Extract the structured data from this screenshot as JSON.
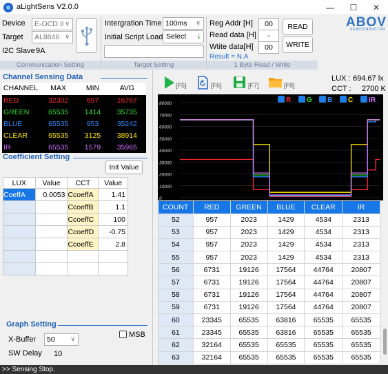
{
  "window": {
    "title": "aLightSens V2.0.0"
  },
  "comm": {
    "device_label": "Device",
    "device_value": "E-OCD II",
    "target_label": "Target",
    "target_value": "AL8846",
    "i2c_label": "I2C Slave",
    "i2c_value": "9A",
    "group_title": "Communication Setting"
  },
  "target": {
    "integration_label": "Intergration Time",
    "integration_value": "100ms",
    "script_label": "Initial Script Load",
    "select_label": "Select",
    "script_path": "",
    "group_title": "Target Setting"
  },
  "rw": {
    "reg_addr_label": "Reg Addr  [H]",
    "reg_addr_value": "00",
    "read_data_label": "Read data [H]",
    "read_data_value": "-",
    "write_data_label": "Wtite data[H]",
    "write_data_value": "00",
    "read_button": "READ",
    "write_button": "WRITE",
    "result": "Result = N.A",
    "group_title": "1 Byte Read / Write"
  },
  "logo": {
    "text": "ABOV",
    "sub": "SEMICONDUCTOR"
  },
  "toolbar": {
    "f5": "[F5]",
    "f6": "[F6]",
    "f7": "[F7]",
    "f8": "[F8]"
  },
  "readout": {
    "lux_label": "LUX :",
    "lux_value": "694.67 lx",
    "cct_label": "CCT :",
    "cct_value": "2700 K"
  },
  "channel": {
    "title": "Channel Sensing Data",
    "headers": [
      "CHANNEL",
      "MAX",
      "MIN",
      "AVG"
    ],
    "rows": [
      {
        "name": "RED",
        "max": "32302",
        "min": "697",
        "avg": "16767"
      },
      {
        "name": "GREEN",
        "max": "65535",
        "min": "1414",
        "avg": "35735"
      },
      {
        "name": "BLUE",
        "max": "65535",
        "min": "953",
        "avg": "35242"
      },
      {
        "name": "CLEAR",
        "max": "65535",
        "min": "3125",
        "avg": "38914"
      },
      {
        "name": "IR",
        "max": "65535",
        "min": "1579",
        "avg": "35965"
      }
    ],
    "colors": {
      "RED": "#ff2a2a",
      "GREEN": "#2fe02f",
      "BLUE": "#2f8bff",
      "CLEAR": "#ffe600",
      "IR": "#d070ff"
    }
  },
  "coef": {
    "title": "Coefficient Setting",
    "init_button": "Init Value",
    "headers": [
      "LUX",
      "Value",
      "CCT",
      "Value"
    ],
    "rows": [
      {
        "lux": "CoeffA",
        "lux_value": "0.0053",
        "cct": "CcoeffA",
        "cct_value": "1.41"
      },
      {
        "lux": "",
        "lux_value": "",
        "cct": "CcoeffB",
        "cct_value": "1.1"
      },
      {
        "lux": "",
        "lux_value": "",
        "cct": "CcoeffC",
        "cct_value": "100"
      },
      {
        "lux": "",
        "lux_value": "",
        "cct": "CcoeffD",
        "cct_value": "-0.75"
      },
      {
        "lux": "",
        "lux_value": "",
        "cct": "CcoeffE",
        "cct_value": "2.8"
      }
    ]
  },
  "graph_setting": {
    "title": "Graph Setting",
    "xbuffer_label": "X-Buffer",
    "xbuffer_value": "50",
    "msb_label": "MSB",
    "msb_checked": false,
    "swdelay_label": "SW Delay",
    "swdelay_value": "10"
  },
  "legend": [
    "R",
    "G",
    "B",
    "C",
    "IR"
  ],
  "chart_data": {
    "type": "line",
    "ylim": [
      0,
      80000
    ],
    "yticks": [
      "80000",
      "70000",
      "60000",
      "50000",
      "40000",
      "30000",
      "20000",
      "10000",
      "0"
    ],
    "x": [
      0,
      1,
      2,
      3,
      4,
      5,
      6,
      7,
      8,
      9,
      10,
      11,
      12,
      13,
      14,
      15,
      16,
      17,
      18,
      19,
      20,
      21,
      22,
      23,
      24,
      25,
      26,
      27,
      28,
      29,
      30,
      31,
      32,
      33,
      34,
      35,
      36,
      37,
      38,
      39,
      40,
      41,
      42,
      43,
      44,
      45,
      46,
      47,
      48,
      49
    ],
    "series": [
      {
        "name": "R",
        "color": "#ff2a2a",
        "values": [
          32164,
          32164,
          32164,
          32164,
          32164,
          32164,
          32164,
          32164,
          32164,
          32164,
          32164,
          32164,
          32164,
          32164,
          32164,
          32164,
          32164,
          32164,
          6731,
          6731,
          6731,
          6731,
          957,
          957,
          957,
          957,
          957,
          957,
          957,
          957,
          957,
          957,
          957,
          957,
          957,
          957,
          957,
          957,
          957,
          957,
          957,
          957,
          6731,
          6731,
          6731,
          6731,
          23345,
          23345,
          32164,
          32164
        ]
      },
      {
        "name": "G",
        "color": "#2fe02f",
        "values": [
          65535,
          65535,
          65535,
          65535,
          65535,
          65535,
          65535,
          65535,
          65535,
          65535,
          65535,
          65535,
          65535,
          65535,
          65535,
          65535,
          65535,
          65535,
          19126,
          19126,
          19126,
          19126,
          2023,
          2023,
          2023,
          2023,
          2023,
          2023,
          2023,
          2023,
          2023,
          2023,
          2023,
          2023,
          2023,
          2023,
          2023,
          2023,
          2023,
          2023,
          2023,
          2023,
          19126,
          19126,
          19126,
          19126,
          65535,
          65535,
          65535,
          65535
        ]
      },
      {
        "name": "B",
        "color": "#2f8bff",
        "values": [
          65535,
          65535,
          65535,
          65535,
          65535,
          65535,
          65535,
          65535,
          65535,
          65535,
          65535,
          65535,
          65535,
          65535,
          65535,
          65535,
          65535,
          65535,
          17564,
          17564,
          17564,
          17564,
          1429,
          1429,
          1429,
          1429,
          1429,
          1429,
          1429,
          1429,
          1429,
          1429,
          1429,
          1429,
          1429,
          1429,
          1429,
          1429,
          1429,
          1429,
          1429,
          1429,
          17564,
          17564,
          17564,
          17564,
          63816,
          63816,
          65535,
          65535
        ]
      },
      {
        "name": "C",
        "color": "#ffe600",
        "values": [
          65535,
          65535,
          65535,
          65535,
          65535,
          65535,
          65535,
          65535,
          65535,
          65535,
          65535,
          65535,
          65535,
          65535,
          65535,
          65535,
          65535,
          65535,
          44764,
          44764,
          44764,
          44764,
          4534,
          4534,
          4534,
          4534,
          4534,
          4534,
          4534,
          4534,
          4534,
          4534,
          4534,
          4534,
          4534,
          4534,
          4534,
          4534,
          4534,
          4534,
          4534,
          4534,
          44764,
          44764,
          44764,
          44764,
          65535,
          65535,
          65535,
          65535
        ]
      },
      {
        "name": "IR",
        "color": "#d070ff",
        "values": [
          65535,
          65535,
          65535,
          65535,
          65535,
          65535,
          65535,
          65535,
          65535,
          65535,
          65535,
          65535,
          65535,
          65535,
          65535,
          65535,
          65535,
          65535,
          20807,
          20807,
          20807,
          20807,
          2313,
          2313,
          2313,
          2313,
          2313,
          2313,
          2313,
          2313,
          2313,
          2313,
          2313,
          2313,
          2313,
          2313,
          2313,
          2313,
          2313,
          2313,
          2313,
          2313,
          20807,
          20807,
          20807,
          20807,
          65535,
          65535,
          65535,
          65535
        ]
      }
    ]
  },
  "table": {
    "headers": [
      "COUNT",
      "RED",
      "GREEN",
      "BLUE",
      "CLEAR",
      "IR"
    ],
    "rows": [
      [
        "52",
        "957",
        "2023",
        "1429",
        "4534",
        "2313"
      ],
      [
        "53",
        "957",
        "2023",
        "1429",
        "4534",
        "2313"
      ],
      [
        "54",
        "957",
        "2023",
        "1429",
        "4534",
        "2313"
      ],
      [
        "55",
        "957",
        "2023",
        "1429",
        "4534",
        "2313"
      ],
      [
        "56",
        "6731",
        "19126",
        "17564",
        "44764",
        "20807"
      ],
      [
        "57",
        "6731",
        "19126",
        "17564",
        "44764",
        "20807"
      ],
      [
        "58",
        "6731",
        "19126",
        "17564",
        "44764",
        "20807"
      ],
      [
        "59",
        "6731",
        "19126",
        "17564",
        "44764",
        "20807"
      ],
      [
        "60",
        "23345",
        "65535",
        "63816",
        "65535",
        "65535"
      ],
      [
        "61",
        "23345",
        "65535",
        "63816",
        "65535",
        "65535"
      ],
      [
        "62",
        "32164",
        "65535",
        "65535",
        "65535",
        "65535"
      ],
      [
        "63",
        "32164",
        "65535",
        "65535",
        "65535",
        "65535"
      ]
    ]
  },
  "status": {
    "text": ">> Sensing Stop."
  }
}
